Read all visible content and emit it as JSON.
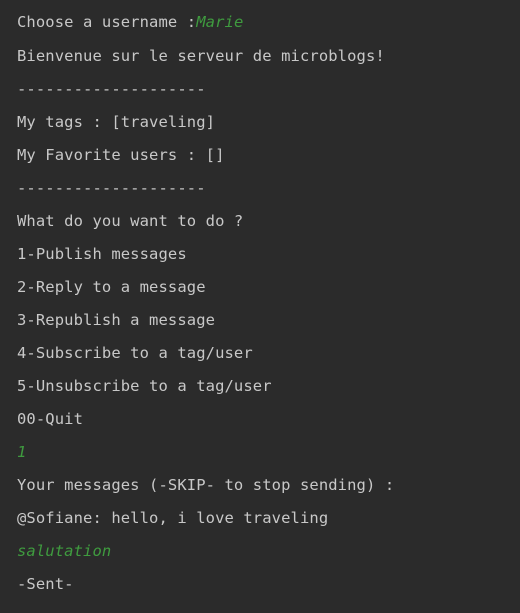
{
  "console": {
    "username_prompt": "Choose a username :",
    "username_value": "Marie",
    "welcome": "Bienvenue sur le serveur de microblogs!",
    "separator_1": "--------------------",
    "my_tags": "My tags : [traveling]",
    "favorite_users": "My Favorite users : []",
    "separator_2": "--------------------",
    "menu_prompt": "What do you want to do ?",
    "menu": [
      "1-Publish messages",
      "2-Reply to a message",
      "3-Republish a message",
      "4-Subscribe to a tag/user",
      "5-Unsubscribe to a tag/user",
      "00-Quit"
    ],
    "choice_input": "1",
    "messages_prompt": "Your messages (-SKIP- to stop sending) :",
    "received_message": "@Sofiane: hello, i love traveling",
    "message_input": "salutation",
    "sent_status": "-Sent-"
  },
  "colors": {
    "background": "#2b2b2b",
    "output_text": "#c8c8c8",
    "user_input": "#3f9b3f"
  }
}
